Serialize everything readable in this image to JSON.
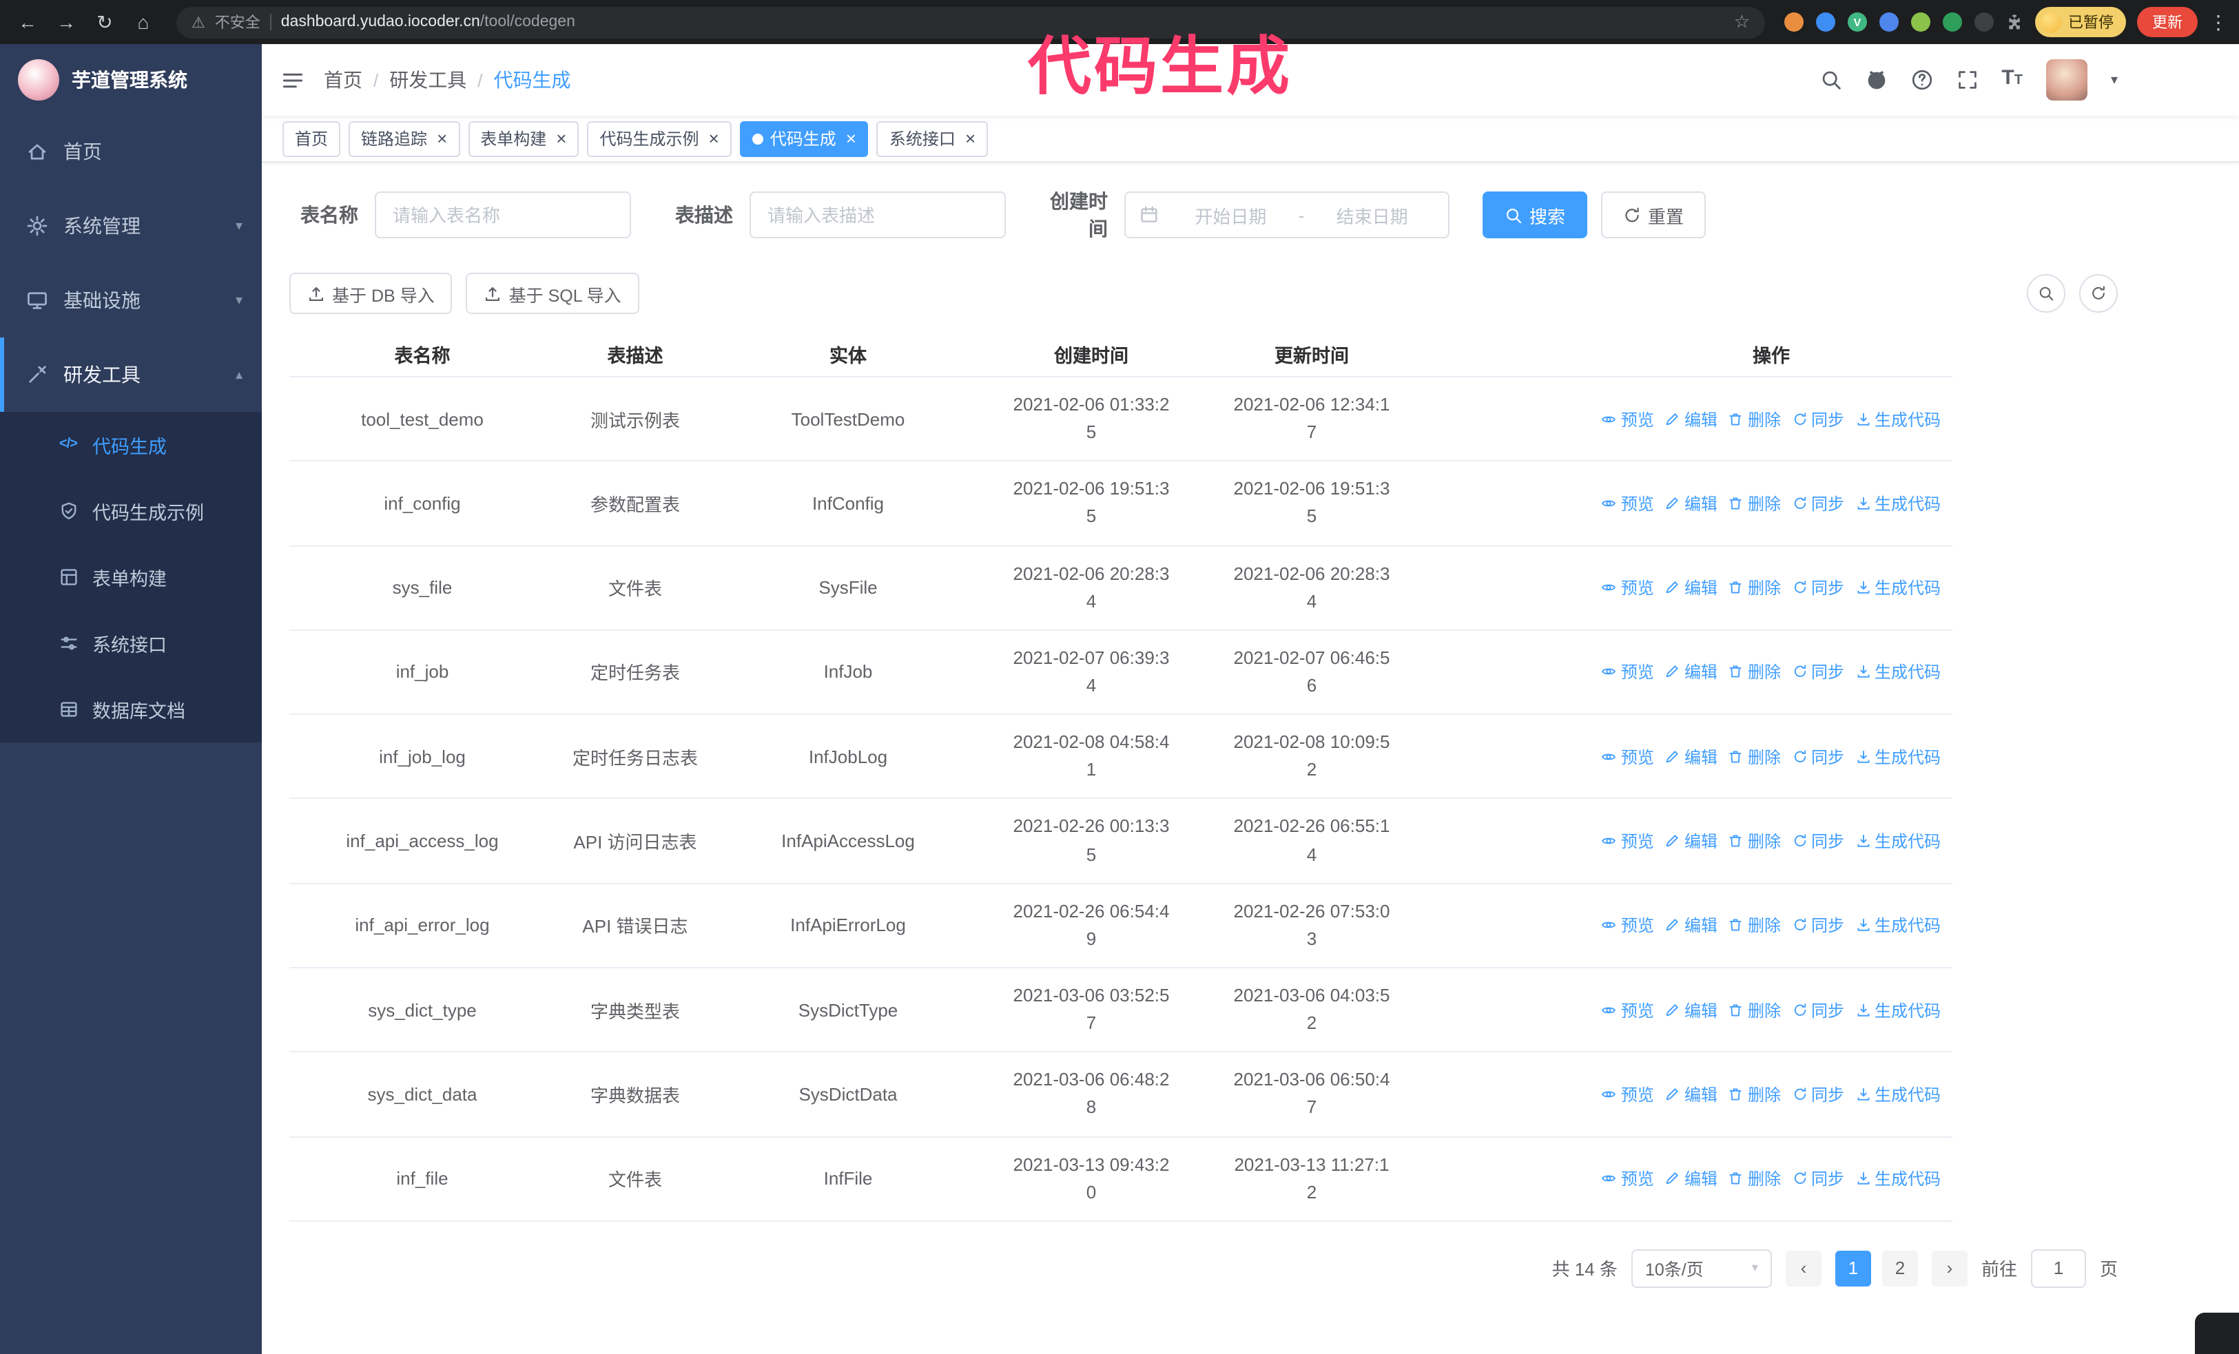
{
  "annotation": {
    "text": "代码生成",
    "color": "#fb3b6b"
  },
  "browser": {
    "security_text": "不安全",
    "url_host": "dashboard.yudao.iocoder.cn",
    "url_path": "/tool/codegen",
    "paused_badge": "已暂停",
    "update_button": "更新",
    "extensions": [
      {
        "color": "#e98e3f",
        "letter": ""
      },
      {
        "color": "#3d8df5",
        "letter": ""
      },
      {
        "color": "#41b883",
        "letter": "V"
      },
      {
        "color": "#4f86ec",
        "letter": ""
      },
      {
        "color": "#8bc34a",
        "letter": ""
      },
      {
        "color": "#2e9e5b",
        "letter": ""
      },
      {
        "color": "#3c4043",
        "letter": ""
      }
    ]
  },
  "sidebar": {
    "logo_title": "芋道管理系统",
    "items": [
      {
        "label": "首页",
        "icon": "home",
        "chevron": "",
        "expanded": false
      },
      {
        "label": "系统管理",
        "icon": "gear",
        "chevron": "down",
        "expanded": false
      },
      {
        "label": "基础设施",
        "icon": "platform",
        "chevron": "down",
        "expanded": false
      },
      {
        "label": "研发工具",
        "icon": "tools",
        "chevron": "up",
        "expanded": true
      }
    ],
    "submenu": [
      {
        "label": "代码生成",
        "icon": "code",
        "active": true
      },
      {
        "label": "代码生成示例",
        "icon": "shield",
        "active": false
      },
      {
        "label": "表单构建",
        "icon": "form",
        "active": false
      },
      {
        "label": "系统接口",
        "icon": "api",
        "active": false
      },
      {
        "label": "数据库文档",
        "icon": "db",
        "active": false
      }
    ]
  },
  "header": {
    "breadcrumb": [
      "首页",
      "研发工具",
      "代码生成"
    ],
    "separator": "/"
  },
  "tabs": [
    {
      "label": "首页",
      "closable": false,
      "active": false
    },
    {
      "label": "链路追踪",
      "closable": true,
      "active": false
    },
    {
      "label": "表单构建",
      "closable": true,
      "active": false
    },
    {
      "label": "代码生成示例",
      "closable": true,
      "active": false
    },
    {
      "label": "代码生成",
      "closable": true,
      "active": true
    },
    {
      "label": "系统接口",
      "closable": true,
      "active": false
    }
  ],
  "filters": {
    "table_name_label": "表名称",
    "table_name_placeholder": "请输入表名称",
    "table_desc_label": "表描述",
    "table_desc_placeholder": "请输入表描述",
    "create_time_label": "创建时间",
    "date_start_placeholder": "开始日期",
    "date_separator": "-",
    "date_end_placeholder": "结束日期",
    "search_button": "搜索",
    "reset_button": "重置"
  },
  "toolbar": {
    "import_db": "基于 DB 导入",
    "import_sql": "基于 SQL 导入"
  },
  "table": {
    "columns": [
      "表名称",
      "表描述",
      "实体",
      "创建时间",
      "更新时间",
      "操作"
    ],
    "actions": [
      "预览",
      "编辑",
      "删除",
      "同步",
      "生成代码"
    ],
    "rows": [
      {
        "name": "tool_test_demo",
        "desc": "测试示例表",
        "entity": "ToolTestDemo",
        "created": "2021-02-06 01:33:25",
        "updated": "2021-02-06 12:34:17"
      },
      {
        "name": "inf_config",
        "desc": "参数配置表",
        "entity": "InfConfig",
        "created": "2021-02-06 19:51:35",
        "updated": "2021-02-06 19:51:35"
      },
      {
        "name": "sys_file",
        "desc": "文件表",
        "entity": "SysFile",
        "created": "2021-02-06 20:28:34",
        "updated": "2021-02-06 20:28:34"
      },
      {
        "name": "inf_job",
        "desc": "定时任务表",
        "entity": "InfJob",
        "created": "2021-02-07 06:39:34",
        "updated": "2021-02-07 06:46:56"
      },
      {
        "name": "inf_job_log",
        "desc": "定时任务日志表",
        "entity": "InfJobLog",
        "created": "2021-02-08 04:58:41",
        "updated": "2021-02-08 10:09:52"
      },
      {
        "name": "inf_api_access_log",
        "desc": "API 访问日志表",
        "entity": "InfApiAccessLog",
        "created": "2021-02-26 00:13:35",
        "updated": "2021-02-26 06:55:14"
      },
      {
        "name": "inf_api_error_log",
        "desc": "API 错误日志",
        "entity": "InfApiErrorLog",
        "created": "2021-02-26 06:54:49",
        "updated": "2021-02-26 07:53:03"
      },
      {
        "name": "sys_dict_type",
        "desc": "字典类型表",
        "entity": "SysDictType",
        "created": "2021-03-06 03:52:57",
        "updated": "2021-03-06 04:03:52"
      },
      {
        "name": "sys_dict_data",
        "desc": "字典数据表",
        "entity": "SysDictData",
        "created": "2021-03-06 06:48:28",
        "updated": "2021-03-06 06:50:47"
      },
      {
        "name": "inf_file",
        "desc": "文件表",
        "entity": "InfFile",
        "created": "2021-03-13 09:43:20",
        "updated": "2021-03-13 11:27:12"
      }
    ]
  },
  "pagination": {
    "total": "共 14 条",
    "page_size": "10条/页",
    "pages": [
      "1",
      "2"
    ],
    "active_page": "1",
    "goto_label": "前往",
    "goto_value": "1",
    "goto_suffix": "页"
  },
  "colors": {
    "accent": "#409eff",
    "sidebar_bg": "#2f3d5c",
    "submenu_bg": "#222e4a",
    "tag_active": "#409eff",
    "annotation": "#fb3b6b"
  }
}
